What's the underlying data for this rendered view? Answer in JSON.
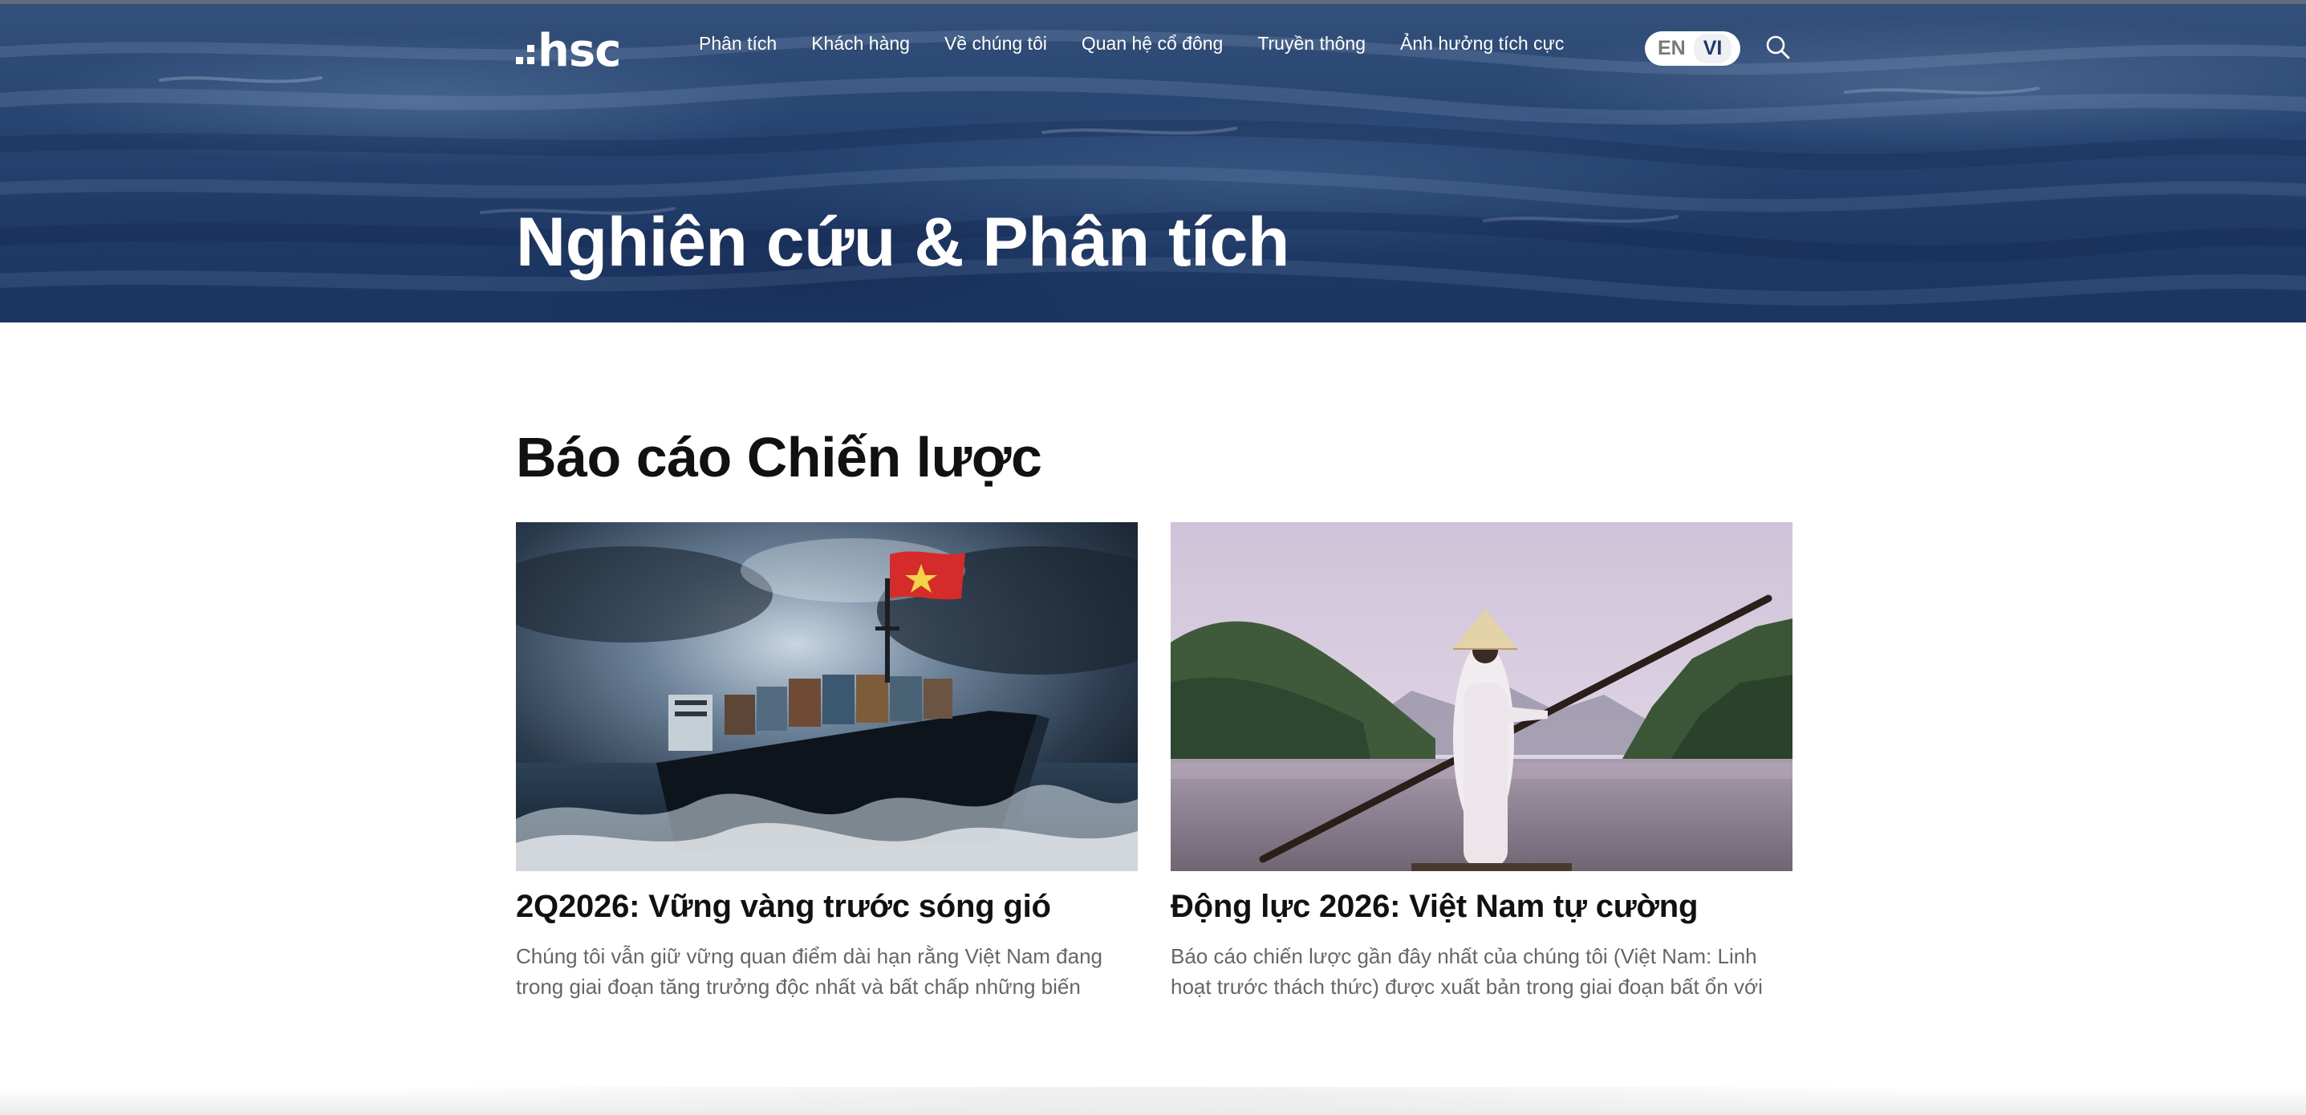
{
  "header": {
    "logo_text": "hsc",
    "nav": [
      {
        "label": "Phân tích"
      },
      {
        "label": "Khách hàng"
      },
      {
        "label": "Về chúng tôi"
      },
      {
        "label": "Quan hệ cổ đông"
      },
      {
        "label": "Truyền thông"
      },
      {
        "label": "Ảnh hưởng tích cực"
      }
    ],
    "lang": {
      "en": "EN",
      "vi": "VI",
      "active": "VI"
    },
    "search_icon": "search-icon"
  },
  "hero": {
    "title": "Nghiên cứu & Phân tích"
  },
  "section": {
    "title": "Báo cáo Chiến lược",
    "cards": [
      {
        "title": "2Q2026: Vững vàng trước sóng gió",
        "excerpt": "Chúng tôi vẫn giữ vững quan điểm dài hạn rằng Việt Nam đang trong giai đoạn tăng trưởng độc nhất và bất chấp những biến độn...",
        "image": "cargo-ship-with-vietnam-flag-in-storm"
      },
      {
        "title": "Động lực 2026: Việt Nam tự cường",
        "excerpt": "Báo cáo chiến lược gần đây nhất của chúng tôi (Việt Nam: Linh hoạt trước thách thức) được xuất bản trong giai đoạn bất ổn với tâm để...",
        "image": "woman-in-ao-dai-and-conical-hat-on-river"
      }
    ]
  },
  "colors": {
    "hero_bg": "#243f6c",
    "accent": "#1c3a6b",
    "flag_red": "#d62b2b",
    "flag_star": "#f3d34a"
  }
}
